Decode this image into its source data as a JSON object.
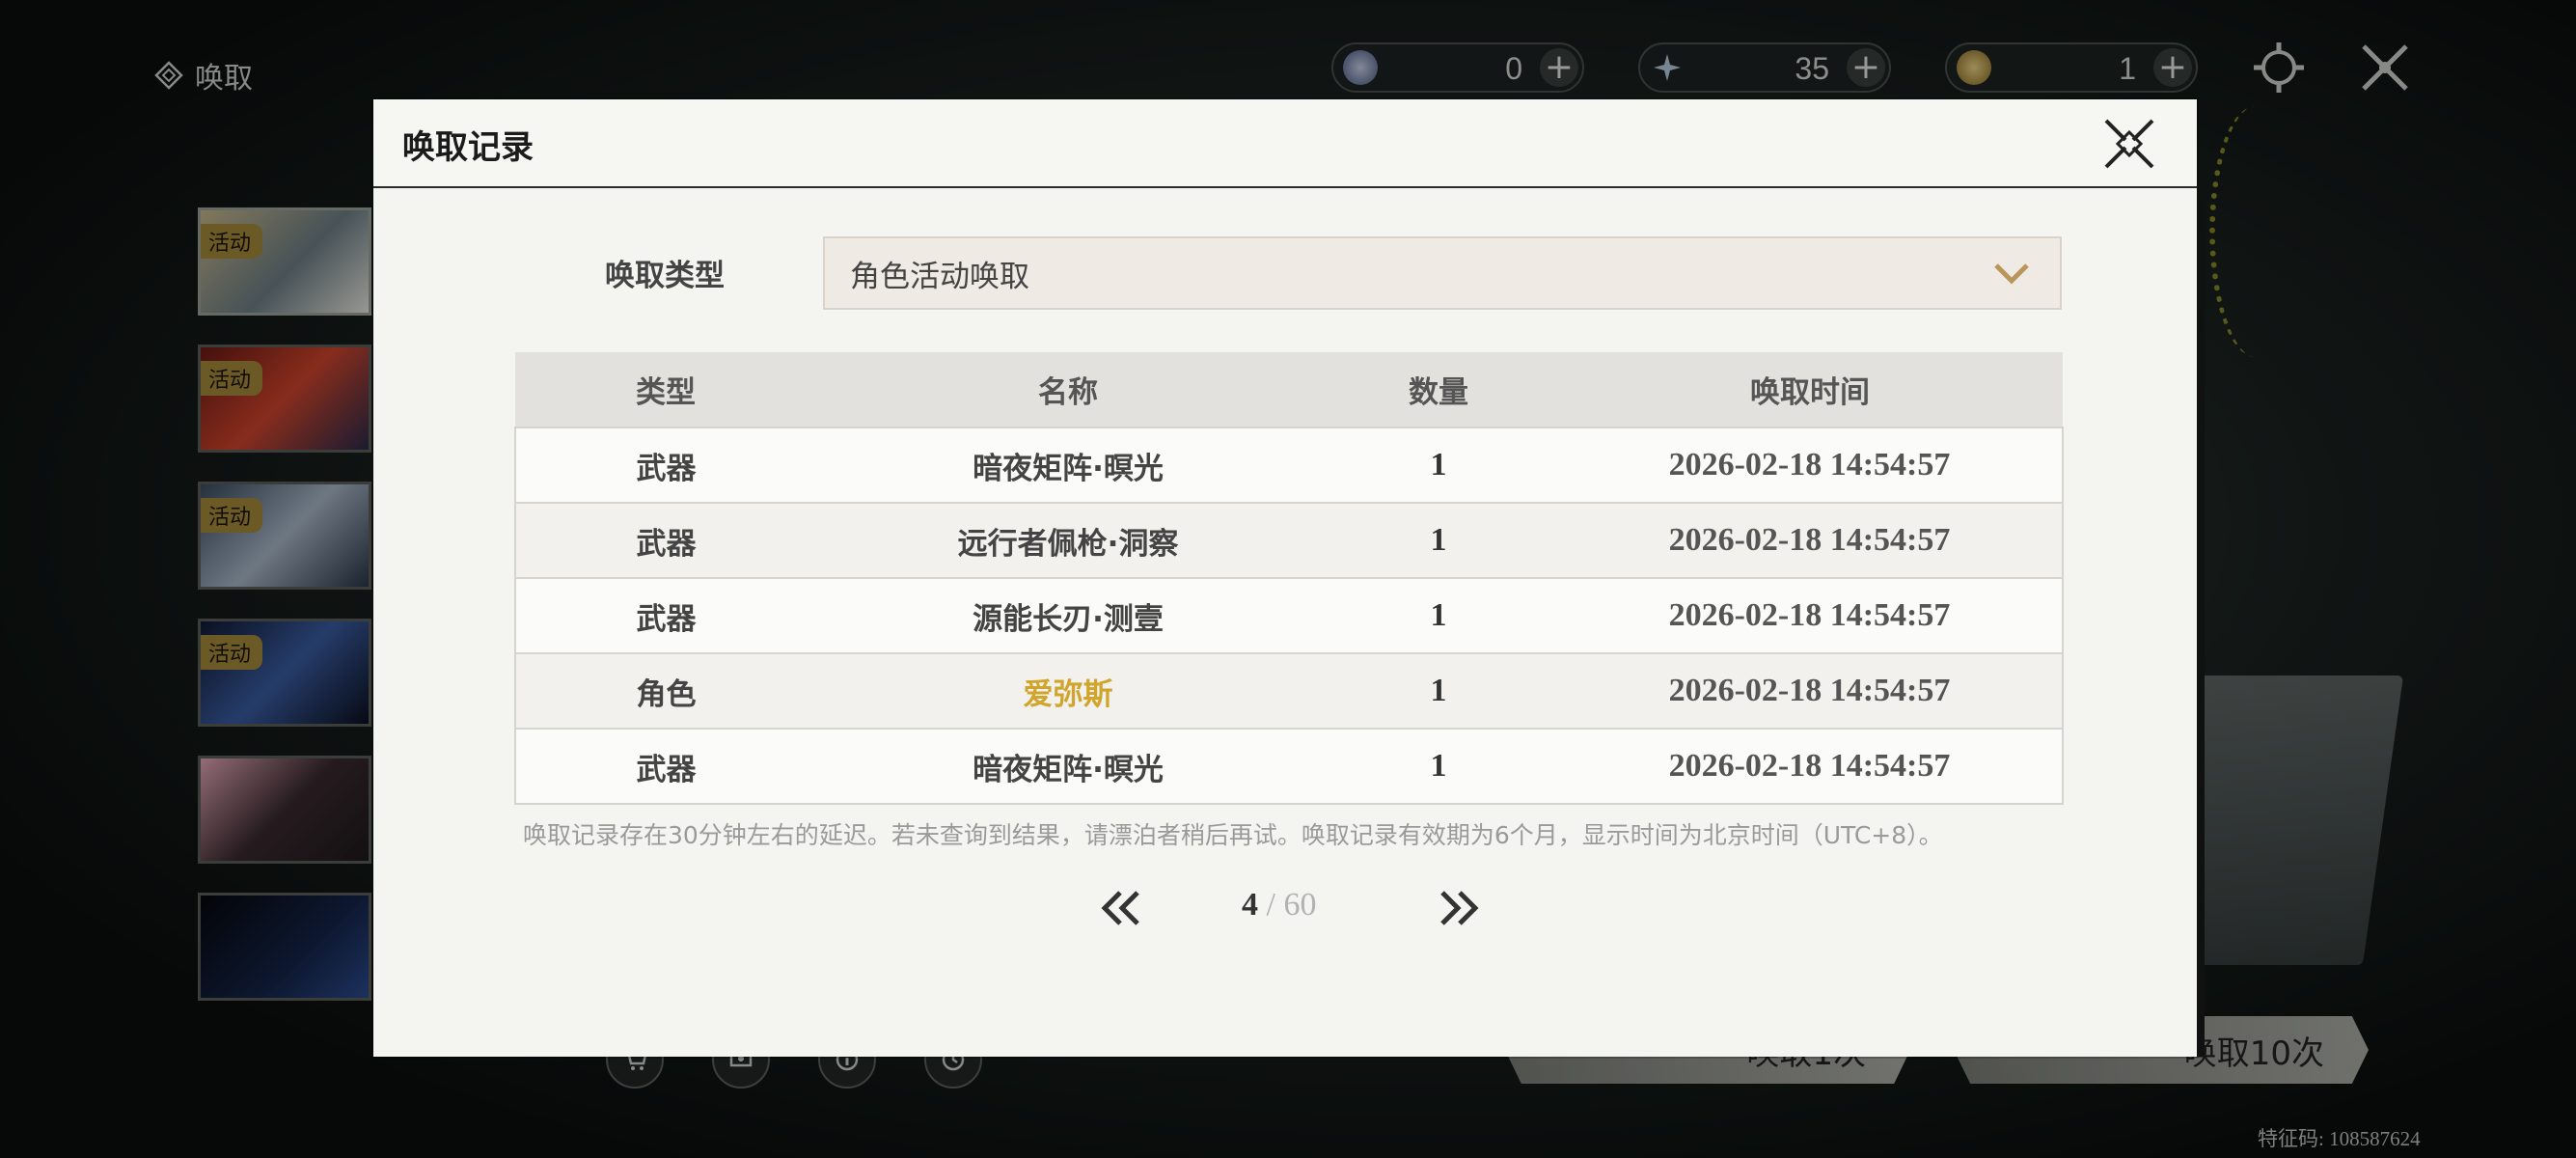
{
  "page": {
    "title": "唤取"
  },
  "banners": [
    {
      "tag": "活动"
    },
    {
      "tag": "活动"
    },
    {
      "tag": "活动"
    },
    {
      "tag": "活动"
    },
    {
      "tag": ""
    },
    {
      "tag": ""
    }
  ],
  "currencies": [
    {
      "icon": "astrite-coin-icon",
      "value": "0"
    },
    {
      "icon": "crystal-star-icon",
      "value": "35"
    },
    {
      "icon": "gold-tide-icon",
      "value": "1"
    }
  ],
  "pull_buttons": {
    "single": "唤取1次",
    "ten": "唤取10次"
  },
  "uid_text": "特征码: 108587624",
  "modal": {
    "title": "唤取记录",
    "type_label": "唤取类型",
    "type_selected": "角色活动唤取",
    "columns": [
      "类型",
      "名称",
      "数量",
      "唤取时间"
    ],
    "rows": [
      {
        "type": "武器",
        "name": "暗夜矩阵·暝光",
        "count": "1",
        "time": "2026-02-18 14:54:57",
        "highlight": false
      },
      {
        "type": "武器",
        "name": "远行者佩枪·洞察",
        "count": "1",
        "time": "2026-02-18 14:54:57",
        "highlight": false
      },
      {
        "type": "武器",
        "name": "源能长刃·测壹",
        "count": "1",
        "time": "2026-02-18 14:54:57",
        "highlight": false
      },
      {
        "type": "角色",
        "name": "爱弥斯",
        "count": "1",
        "time": "2026-02-18 14:54:57",
        "highlight": true
      },
      {
        "type": "武器",
        "name": "暗夜矩阵·暝光",
        "count": "1",
        "time": "2026-02-18 14:54:57",
        "highlight": false
      }
    ],
    "notice": "唤取记录存在30分钟左右的延迟。若未查询到结果，请漂泊者稍后再试。唤取记录有效期为6个月，显示时间为北京时间（UTC+8）。",
    "pagination": {
      "current": "4",
      "separator": " / ",
      "total": "60"
    }
  },
  "colors": {
    "highlight_gold": "#d1a52b",
    "accent_tan": "#b9965a"
  }
}
